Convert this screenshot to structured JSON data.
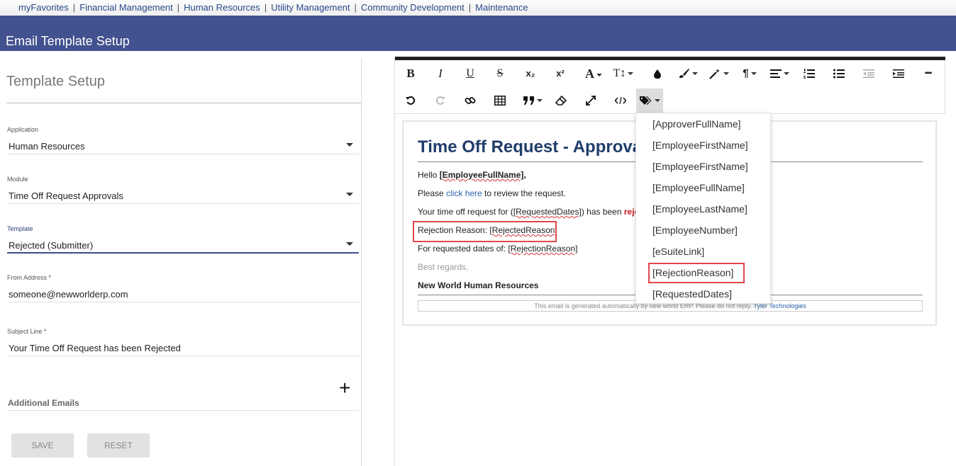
{
  "topnav": {
    "items": [
      "myFavorites",
      "Financial Management",
      "Human Resources",
      "Utility Management",
      "Community Development",
      "Maintenance"
    ],
    "separator": "|"
  },
  "header": {
    "title": "Email Template Setup"
  },
  "left": {
    "section_title": "Template Setup",
    "application": {
      "label": "Application",
      "value": "Human Resources"
    },
    "module": {
      "label": "Module",
      "value": "Time Off Request Approvals"
    },
    "template": {
      "label": "Template",
      "value": "Rejected (Submitter)"
    },
    "from_address": {
      "label": "From Address *",
      "value": "someone@newworlderp.com"
    },
    "subject_line": {
      "label": "Subject Line *",
      "value": "Your Time Off Request has been Rejected"
    },
    "additional_emails": {
      "label": "Additional Emails",
      "add_symbol": "+"
    },
    "save_label": "SAVE",
    "reset_label": "RESET"
  },
  "toolbar": {
    "bold": "B",
    "italic": "I",
    "underline": "U",
    "strike": "S",
    "subscript": "x₂",
    "superscript": "x²",
    "font": "A",
    "fontsize": "T↕",
    "paragraph": "¶",
    "hr": "━"
  },
  "email": {
    "heading": "Time Off Request - Approva",
    "hello": "Hello ",
    "employee_full_name": "[EmployeeFullName]",
    "hello_suffix": ",",
    "please": "Please ",
    "click_here": "click here",
    "to_review": " to review the request.",
    "line3_pre": "Your time off request for (",
    "requested_dates": "[RequestedDates]",
    "line3_mid": ") has been ",
    "line3_status": "reje",
    "rejection_reason_label": "Rejection Reason: ",
    "rejected_reason_tag": "[RejectedReason]",
    "requested_dates_label": "For requested dates of: ",
    "rejection_reason_tag": "[RejectionReason]",
    "regards": "Best regards,",
    "signature": "New World Human Resources",
    "footer_text": "This email is generated automatically by new world ERP. Please do not reply. ",
    "footer_link": "Tyler Technologies"
  },
  "merge_fields": [
    "[ApproverFullName]",
    "[EmployeeFirstName]",
    "[EmployeeFirstName]",
    "[EmployeeFullName]",
    "[EmployeeLastName]",
    "[EmployeeNumber]",
    "[eSuiteLink]",
    "[RejectionReason]",
    "[RequestedDates]"
  ],
  "colors": {
    "header_bg": "#42528f",
    "nav_link": "#2c4a8a",
    "heading": "#1f3d6b",
    "highlight": "#e0474c",
    "status_red": "#c0151a"
  }
}
